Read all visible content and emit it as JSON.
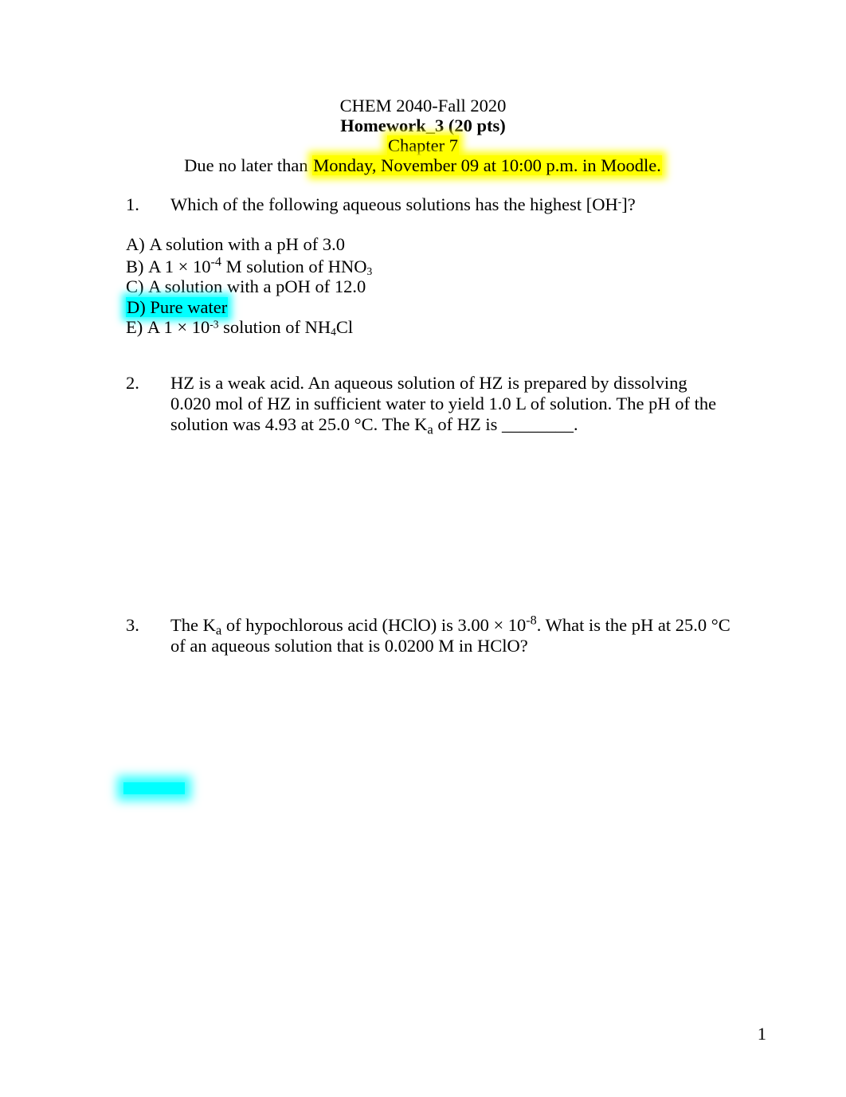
{
  "document": {
    "page_number": "1",
    "highlight_colors": {
      "yellow": "#ffff00",
      "cyan": "#00ffff"
    }
  },
  "header": {
    "course": "CHEM 2040-Fall 2020",
    "assignment": "Homework_3 (20 pts)",
    "chapter": "Chapter 7",
    "due_prefix": "Due no later than ",
    "due_highlighted": "Monday, November 09 at 10:00 p.m. in Moodle."
  },
  "questions": [
    {
      "number": "1.",
      "text_before": "Which of the following aqueous solutions has the highest [OH",
      "superscript": "-",
      "text_after": "]?",
      "options": [
        {
          "label": "A)",
          "text": "A solution with a pH of 3.0",
          "highlight": "none"
        },
        {
          "label": "B)",
          "prefix": "A 1 × 10",
          "exponent": "-4",
          "suffix": " M solution of HNO",
          "subscript": "3",
          "highlight": "none"
        },
        {
          "label": "C)",
          "text": "A solution with a pOH of 12.0",
          "highlight": "none"
        },
        {
          "label": "D)",
          "text": "Pure water",
          "highlight": "cyan"
        },
        {
          "label": "E)",
          "prefix": "A 1 × 10",
          "exponent": "-3",
          "suffix": " solution of NH",
          "subscript": "4",
          "tail": "Cl",
          "highlight": "none"
        }
      ]
    },
    {
      "number": "2.",
      "part1": "HZ is a weak acid. An aqueous solution of HZ is prepared by dissolving 0.020 mol of HZ in sufficient water to yield 1.0 L of solution. The pH of the solution was 4.93 at 25.0 °C. The K",
      "subscript": "a",
      "part2": " of HZ is ________."
    },
    {
      "number": "3.",
      "part1": "The K",
      "subscript": "a",
      "part2": " of hypochlorous acid (HClO) is 3.00 × 10",
      "exponent": "-8",
      "part3": ". What is the pH at 25.0 °C of an aqueous solution that is 0.0200 M in HClO?"
    }
  ]
}
